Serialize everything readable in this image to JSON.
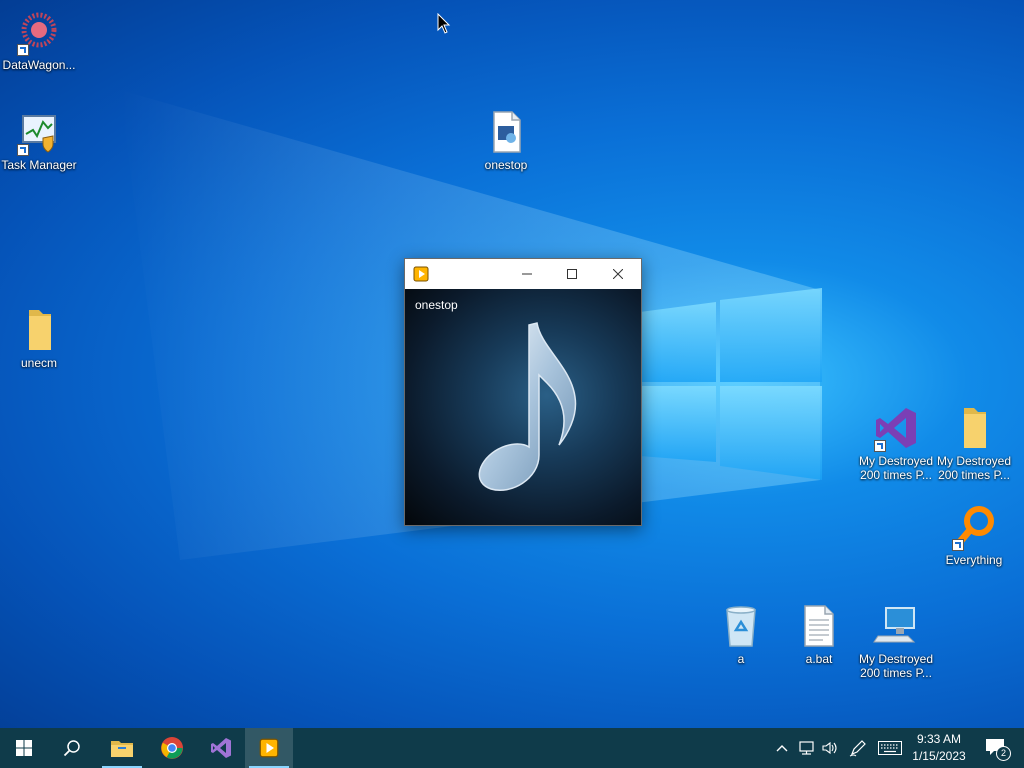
{
  "desktop": {
    "icons": {
      "datawagon": "DataWagon...",
      "taskmgr": "Task Manager",
      "onestop": "onestop",
      "unecm": "unecm",
      "vs_proj": "My Destroyed 200 times P...",
      "folder_proj": "My Destroyed 200 times P...",
      "everything": "Everything",
      "recycle": "a",
      "abat": "a.bat",
      "thispc": "My Destroyed 200 times P..."
    }
  },
  "window": {
    "file_name": "onestop",
    "minimize_symbol": "—",
    "colors": {
      "accent": "#ffb400"
    }
  },
  "taskbar": {
    "clock": {
      "time": "9:33 AM",
      "date": "1/15/2023"
    },
    "notification_count": "2",
    "color": "#0f3b4a"
  }
}
